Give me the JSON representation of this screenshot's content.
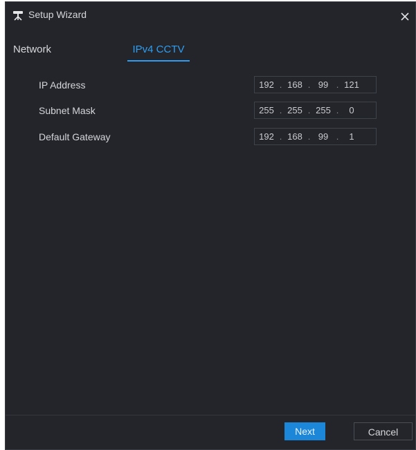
{
  "window": {
    "title": "Setup Wizard",
    "title_icon": "camera-tripod-icon",
    "close_icon": "close-icon"
  },
  "tabs": [
    {
      "label": "Network",
      "active": false
    },
    {
      "label": "IPv4 CCTV",
      "active": true
    }
  ],
  "form": {
    "rows": [
      {
        "label": "IP Address",
        "octets": [
          "192",
          "168",
          "99",
          "121"
        ]
      },
      {
        "label": "Subnet Mask",
        "octets": [
          "255",
          "255",
          "255",
          "0"
        ]
      },
      {
        "label": "Default Gateway",
        "octets": [
          "192",
          "168",
          "99",
          "1"
        ]
      }
    ],
    "separator": "."
  },
  "footer": {
    "next_label": "Next",
    "cancel_label": "Cancel"
  },
  "colors": {
    "background": "#23252a",
    "accent": "#2f9ef0",
    "primary_button": "#1c86d8"
  }
}
